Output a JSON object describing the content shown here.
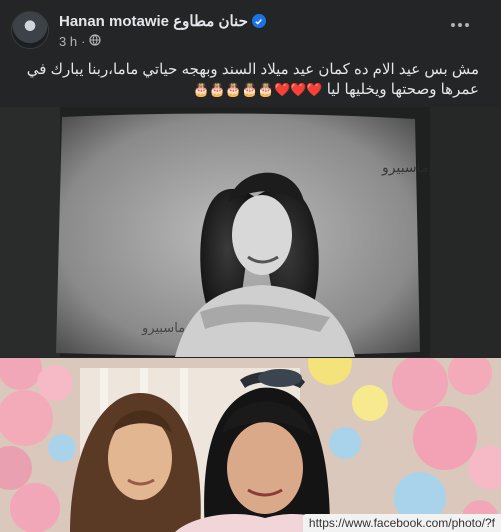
{
  "post": {
    "author": "Hanan motawie حنان مطاوع",
    "time": "3 h",
    "separator": "·",
    "caption_text": "مش بس عيد الام ده كمان عيد ميلاد السند وبهجه حياتي ماما،ربنا يبارك في عمرها وصحتها ويخليها ليا",
    "caption_emojis": "❤️❤️❤️🎂🎂🎂🎂🎂",
    "images": [
      {
        "kind": "vintage-tv-photo",
        "watermark": "ماسبيرو"
      },
      {
        "kind": "balloon-party-photo"
      }
    ]
  },
  "browser": {
    "status_url": "https://www.facebook.com/photo/?f"
  },
  "colors": {
    "background": "#242526",
    "verified": "#1b74e4",
    "text": "#e4e6eb",
    "meta": "#b0b3b8"
  }
}
